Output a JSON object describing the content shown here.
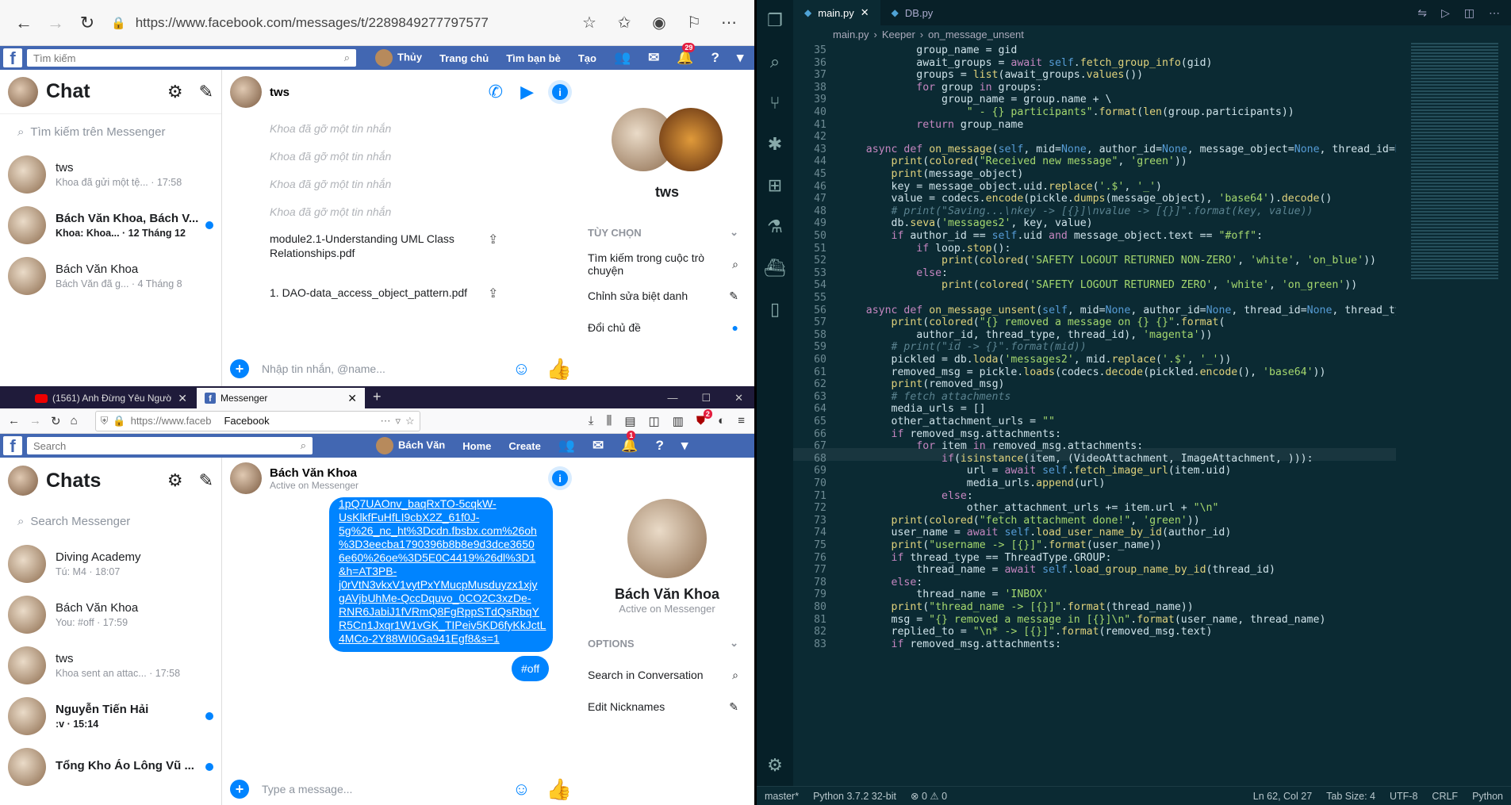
{
  "top_browser": {
    "url": "https://www.facebook.com/messages/t/2289849277797577"
  },
  "fb_top": {
    "search_placeholder": "Tìm kiếm",
    "profile": "Thủy",
    "nav": [
      "Trang chủ",
      "Tìm bạn bè",
      "Tạo"
    ],
    "notif_count": "29"
  },
  "top_msgr": {
    "title": "Chat",
    "search": "Tìm kiếm trên Messenger",
    "convs": [
      {
        "name": "tws",
        "preview": "Khoa đã gửi một tệ... · 17:58",
        "bold": false
      },
      {
        "name": "Bách Văn Khoa, Bách V...",
        "preview": "Khoa: Khoa... · 12 Tháng 12",
        "bold": true
      },
      {
        "name": "Bách Văn Khoa",
        "preview": "Bách Văn đã g... · 4 Tháng 8",
        "bold": false
      }
    ],
    "thread_name": "tws",
    "unsent": [
      "Khoa đã gỡ một tin nhắn",
      "Khoa đã gỡ một tin nhắn",
      "Khoa đã gỡ một tin nhắn",
      "Khoa đã gỡ một tin nhắn"
    ],
    "files": [
      "module2.1-Understanding UML Class Relationships.pdf",
      "1. DAO-data_access_object_pattern.pdf"
    ],
    "composer": "Nhập tin nhắn, @name...",
    "right_name": "tws",
    "options_header": "TÙY CHỌN",
    "options": [
      "Tìm kiếm trong cuộc trò chuyện",
      "Chỉnh sửa biệt danh",
      "Đổi chủ đề"
    ]
  },
  "ff": {
    "tab1": "(1561) Anh Đừng Yêu Người",
    "tab2": "Messenger",
    "url": "https://www.faceb",
    "site": "Facebook",
    "badge": "2"
  },
  "fb_bot": {
    "search_placeholder": "Search",
    "profile": "Bách Văn",
    "nav": [
      "Home",
      "Create"
    ],
    "notif_count": "1"
  },
  "bot_msgr": {
    "title": "Chats",
    "search": "Search Messenger",
    "convs": [
      {
        "name": "Diving Academy",
        "preview": "Tú: M4 · 18:07",
        "bold": false,
        "dot": false
      },
      {
        "name": "Bách Văn Khoa",
        "preview": "You: #off · 17:59",
        "bold": false,
        "dot": false
      },
      {
        "name": "tws",
        "preview": "Khoa sent an attac... · 17:58",
        "bold": false,
        "dot": false
      },
      {
        "name": "Nguyễn Tiến Hải",
        "preview": ":v · 15:14",
        "bold": true,
        "dot": true
      },
      {
        "name": "Tổng Kho Áo Lông Vũ ...",
        "preview": "",
        "bold": true,
        "dot": true
      }
    ],
    "thread_name": "Bách Văn Khoa",
    "thread_sub": "Active on Messenger",
    "link_lines": [
      "1pQ7UAOnv_baqRxTO-5cqkW-",
      "UsKlkfFuHfLI9cbX2Z_61f0J-",
      "5g%26_nc_ht%3Dcdn.fbsbx.com%26oh",
      "%3D3eecba1790396b8b8e9d3dce3650",
      "6e60%26oe%3D5E0C4419%26dl%3D1",
      "&h=AT3PB-",
      "j0rVtN3vkxV1vytPxYMucpMusduyzx1xjy",
      "gAVjbUhMe-QccDquvo_0CO2C3xzDe-",
      "RNR6JabiJ1fVRmQ8FgRppSTdQsRbqY",
      "R5Cn1Jxqr1W1vGK_TIPeiv5KD6fyKkJctL",
      "4MCo-2Y88WI0Ga941Egf8&s=1"
    ],
    "off_msg": "#off",
    "composer": "Type a message...",
    "right_name": "Bách Văn Khoa",
    "right_sub": "Active on Messenger",
    "options_header": "OPTIONS",
    "options": [
      "Search in Conversation",
      "Edit Nicknames"
    ]
  },
  "vscode": {
    "tabs": [
      "main.py",
      "DB.py"
    ],
    "breadcrumb": [
      "main.py",
      "Keeper",
      "on_message_unsent"
    ],
    "status": {
      "branch": "master*",
      "python": "Python 3.7.2 32-bit",
      "errors": "⊗ 0 ⚠ 0",
      "pos": "Ln 62, Col 27",
      "tab": "Tab Size: 4",
      "enc": "UTF-8",
      "eol": "CRLF",
      "lang": "Python"
    },
    "first_line": 35,
    "lines": [
      "            group_name = gid",
      "            await_groups = await self.fetch_group_info(gid)",
      "            groups = list(await_groups.values())",
      "            for group in groups:",
      "                group_name = group.name + \\",
      "                    \" - {} participants\".format(len(group.participants))",
      "            return group_name",
      "",
      "    async def on_message(self, mid=None, author_id=None, message_object=None, thread_id=None, t",
      "        print(colored(\"Received new message\", 'green'))",
      "        print(message_object)",
      "        key = message_object.uid.replace('.$', '_')",
      "        value = codecs.encode(pickle.dumps(message_object), 'base64').decode()",
      "        # print(\"Saving...\\nkey -> [{}]\\nvalue -> [{}]\".format(key, value))",
      "        db.seva('messages2', key, value)",
      "        if author_id == self.uid and message_object.text == \"#off\":",
      "            if loop.stop():",
      "                print(colored('SAFETY LOGOUT RETURNED NON-ZERO', 'white', 'on_blue'))",
      "            else:",
      "                print(colored('SAFETY LOGOUT RETURNED ZERO', 'white', 'on_green'))",
      "",
      "    async def on_message_unsent(self, mid=None, author_id=None, thread_id=None, thread_type=Non",
      "        print(colored(\"{} removed a message on {} {}\".format(",
      "            author_id, thread_type, thread_id), 'magenta'))",
      "        # print(\"id -> {}\".format(mid))",
      "        pickled = db.loda('messages2', mid.replace('.$', '_'))",
      "        removed_msg = pickle.loads(codecs.decode(pickled.encode(), 'base64'))",
      "        print(removed_msg)",
      "        # fetch attachments",
      "        media_urls = []",
      "        other_attachment_urls = \"\"",
      "        if removed_msg.attachments:",
      "            for item in removed_msg.attachments:",
      "                if(isinstance(item, (VideoAttachment, ImageAttachment, ))):",
      "                    url = await self.fetch_image_url(item.uid)",
      "                    media_urls.append(url)",
      "                else:",
      "                    other_attachment_urls += item.url + \"\\n\"",
      "        print(colored(\"fetch attachment done!\", 'green'))",
      "        user_name = await self.load_user_name_by_id(author_id)",
      "        print(\"username -> [{}]\".format(user_name))",
      "        if thread_type == ThreadType.GROUP:",
      "            thread_name = await self.load_group_name_by_id(thread_id)",
      "        else:",
      "            thread_name = 'INBOX'",
      "        print(\"thread_name -> [{}]\".format(thread_name))",
      "        msg = \"{} removed a message in [{}]\\n\".format(user_name, thread_name)",
      "        replied_to = \"\\n* -> [{}]\".format(removed_msg.text)",
      "        if removed_msg.attachments:"
    ]
  }
}
